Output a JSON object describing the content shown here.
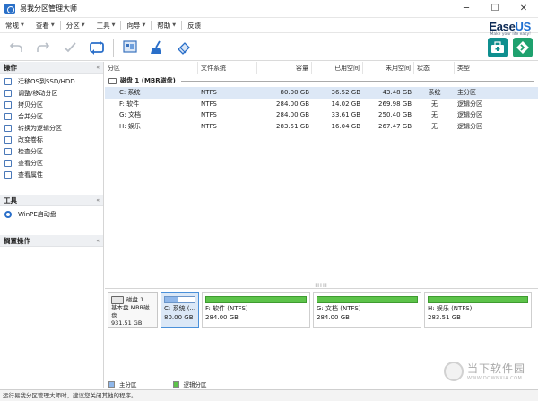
{
  "window": {
    "title": "易我分区管理大师",
    "min": "─",
    "max": "☐",
    "close": "✕"
  },
  "brand": {
    "name_main": "Ease",
    "name_us": "US",
    "tagline": "Make your life easy!"
  },
  "menu": [
    {
      "label": "常规",
      "has_caret": true
    },
    {
      "label": "查看",
      "has_caret": true
    },
    {
      "label": "分区",
      "has_caret": true
    },
    {
      "label": "工具",
      "has_caret": true
    },
    {
      "label": "向导",
      "has_caret": true
    },
    {
      "label": "帮助",
      "has_caret": true
    },
    {
      "label": "反馈",
      "has_caret": false
    }
  ],
  "sidebar": {
    "operations": {
      "header": "操作",
      "collapse": "«",
      "items": [
        "迁移OS到SSD/HDD",
        "调整/移动分区",
        "拷贝分区",
        "合并分区",
        "转换为逻辑分区",
        "改变卷标",
        "检查分区",
        "查看分区",
        "查看属性"
      ]
    },
    "tools": {
      "header": "工具",
      "collapse": "«",
      "items": [
        "WinPE启动盘"
      ]
    },
    "pending": {
      "header": "搁置操作",
      "collapse": "«"
    }
  },
  "grid": {
    "columns": [
      "分区",
      "文件系统",
      "容量",
      "已用空间",
      "未用空间",
      "状态",
      "类型"
    ],
    "disk_label": "磁盘 1 (MBR磁盘)",
    "rows": [
      {
        "name": "C: 系统",
        "fs": "NTFS",
        "capacity": "80.00 GB",
        "used": "36.52 GB",
        "free": "43.48 GB",
        "status": "系统",
        "type": "主分区"
      },
      {
        "name": "F: 软件",
        "fs": "NTFS",
        "capacity": "284.00 GB",
        "used": "14.02 GB",
        "free": "269.98 GB",
        "status": "无",
        "type": "逻辑分区"
      },
      {
        "name": "G: 文档",
        "fs": "NTFS",
        "capacity": "284.00 GB",
        "used": "33.61 GB",
        "free": "250.40 GB",
        "status": "无",
        "type": "逻辑分区"
      },
      {
        "name": "H: 娱乐",
        "fs": "NTFS",
        "capacity": "283.51 GB",
        "used": "16.04 GB",
        "free": "267.47 GB",
        "status": "无",
        "type": "逻辑分区"
      }
    ]
  },
  "map": {
    "splitter": "⁞⁞⁞⁞⁞",
    "disk": {
      "name": "磁盘 1",
      "kind": "基本盘 MBR磁盘",
      "size": "931.51 GB"
    },
    "blocks": [
      {
        "label": "C: 系统 (...",
        "size": "80.00 GB"
      },
      {
        "label": "F: 软件 (NTFS)",
        "size": "284.00 GB"
      },
      {
        "label": "G: 文档 (NTFS)",
        "size": "284.00 GB"
      },
      {
        "label": "H: 娱乐 (NTFS)",
        "size": "283.51 GB"
      }
    ]
  },
  "legend": {
    "primary": "主分区",
    "logical": "逻辑分区",
    "primary_color": "#8fb7ea",
    "logical_color": "#5dc34a"
  },
  "status": {
    "text": "运行易我分区管理大师时，建议您关闭其他的程序。"
  },
  "watermark": {
    "text": "当下软件园",
    "url": "WWW.DOWNXIA.COM"
  }
}
